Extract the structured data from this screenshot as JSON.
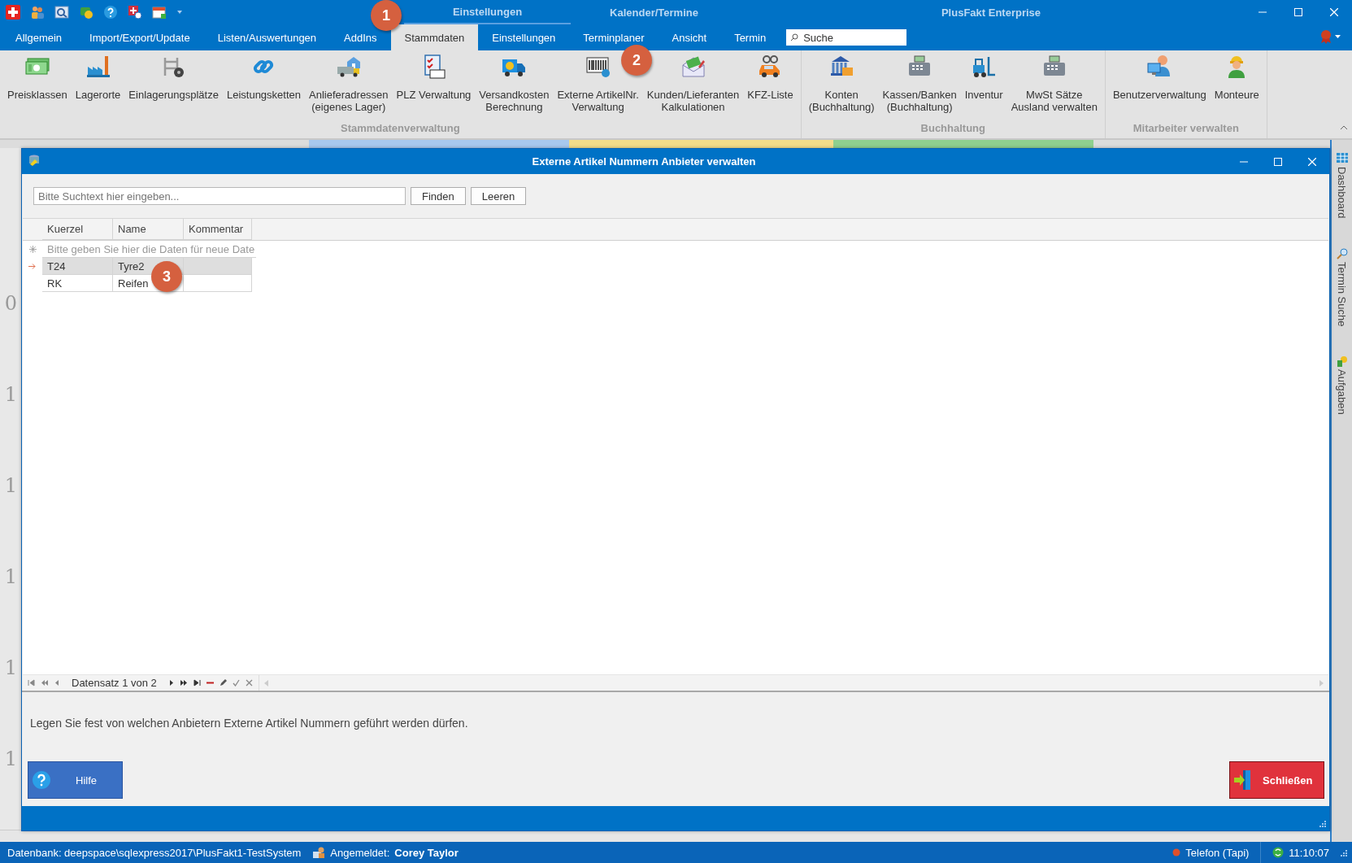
{
  "title_bar": {
    "title": "PlusFakt Enterprise",
    "context_groups": [
      {
        "label": "Einstellungen"
      },
      {
        "label": "Kalender/Termine"
      }
    ]
  },
  "ribbon_tabs": [
    {
      "label": "Allgemein",
      "selected": false
    },
    {
      "label": "Import/Export/Update",
      "selected": false
    },
    {
      "label": "Listen/Auswertungen",
      "selected": false
    },
    {
      "label": "AddIns",
      "selected": false
    },
    {
      "label": "Stammdaten",
      "selected": true
    },
    {
      "label": "Einstellungen",
      "selected": false
    },
    {
      "label": "Terminplaner",
      "selected": false
    },
    {
      "label": "Ansicht",
      "selected": false
    },
    {
      "label": "Termin",
      "selected": false
    }
  ],
  "search": {
    "placeholder": "Suche"
  },
  "ribbon_groups": [
    {
      "title": "Stammdatenverwaltung",
      "buttons": [
        {
          "label": "Preisklassen"
        },
        {
          "label": "Lagerorte"
        },
        {
          "label": "Einlagerungsplätze"
        },
        {
          "label": "Leistungsketten"
        },
        {
          "label": "Anlieferadressen\n(eigenes Lager)"
        },
        {
          "label": "PLZ Verwaltung"
        },
        {
          "label": "Versandkosten\nBerechnung"
        },
        {
          "label": "Externe ArtikelNr.\nVerwaltung"
        },
        {
          "label": "Kunden/Lieferanten\nKalkulationen"
        },
        {
          "label": "KFZ-Liste"
        }
      ]
    },
    {
      "title": "Buchhaltung",
      "buttons": [
        {
          "label": "Konten\n(Buchhaltung)"
        },
        {
          "label": "Kassen/Banken\n(Buchhaltung)"
        },
        {
          "label": "Inventur"
        },
        {
          "label": "MwSt Sätze\nAusland verwalten"
        }
      ]
    },
    {
      "title": "Mitarbeiter verwalten",
      "buttons": [
        {
          "label": "Benutzerverwaltung"
        },
        {
          "label": "Monteure"
        }
      ]
    }
  ],
  "background_numbers": [
    "0",
    "1",
    "1",
    "1",
    "1",
    "1"
  ],
  "sidebar_tabs": [
    {
      "label": "Dashboard"
    },
    {
      "label": "Termin Suche"
    },
    {
      "label": "Aufgaben"
    }
  ],
  "dialog": {
    "title": "Externe Artikel Nummern Anbieter verwalten",
    "search": {
      "placeholder": "Bitte Suchtext hier eingeben..."
    },
    "search_buttons": [
      "Finden",
      "Leeren"
    ],
    "table": {
      "columns": [
        "Kuerzel",
        "Name",
        "Kommentar"
      ],
      "new_row_hint": "Bitte geben Sie hier die Daten für neue Date",
      "rows": [
        {
          "kuerzel": "T24",
          "name": "Tyre2",
          "selected": true
        },
        {
          "kuerzel": "RK",
          "name": "Reifen",
          "selected": false
        }
      ]
    },
    "navigator": {
      "record_text": "Datensatz 1 von 2"
    },
    "description": "Legen Sie fest von welchen Anbietern Externe Artikel Nummern geführt werden dürfen.",
    "help_button": "Hilfe",
    "close_button": "Schließen"
  },
  "status_bar": {
    "database": "Datenbank: deepspace\\sqlexpress2017\\PlusFakt1-TestSystem",
    "logged_in_label": "Angemeldet:",
    "user": "Corey Taylor",
    "phone": "Telefon (Tapi)",
    "time": "11:10:07"
  },
  "callouts": [
    "1",
    "2",
    "3"
  ]
}
